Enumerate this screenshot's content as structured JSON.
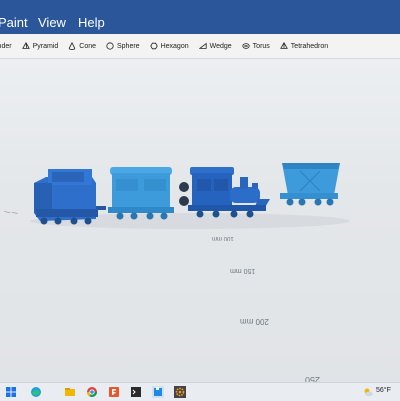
{
  "menu": {
    "items": [
      "Paint",
      "View",
      "Help"
    ]
  },
  "toolbar": {
    "items": [
      {
        "label": "inder",
        "icon": "cylinder-icon"
      },
      {
        "label": "Pyramid",
        "icon": "pyramid-icon"
      },
      {
        "label": "Cone",
        "icon": "cone-icon"
      },
      {
        "label": "Sphere",
        "icon": "sphere-icon"
      },
      {
        "label": "Hexagon",
        "icon": "hexagon-icon"
      },
      {
        "label": "Wedge",
        "icon": "wedge-icon"
      },
      {
        "label": "Torus",
        "icon": "torus-icon"
      },
      {
        "label": "Tetrahedron",
        "icon": "tetrahedron-icon"
      }
    ]
  },
  "viewport": {
    "grid_labels": [
      "100 mm",
      "150 mm",
      "200 mm",
      "250"
    ],
    "models": [
      "locomotive-cab",
      "passenger-car",
      "steam-locomotive",
      "hopper-car"
    ],
    "colors": {
      "dark_blue": "#2e6fcc",
      "light_blue": "#3d9bdc",
      "wheel": "#1f4f8f"
    }
  },
  "taskbar": {
    "icons": [
      "windows-start-icon",
      "edge-icon",
      "file-explorer-icon",
      "chrome-icon",
      "app-icon",
      "terminal-icon",
      "cube-app-icon",
      "settings-icon"
    ],
    "temperature": "56°F"
  }
}
